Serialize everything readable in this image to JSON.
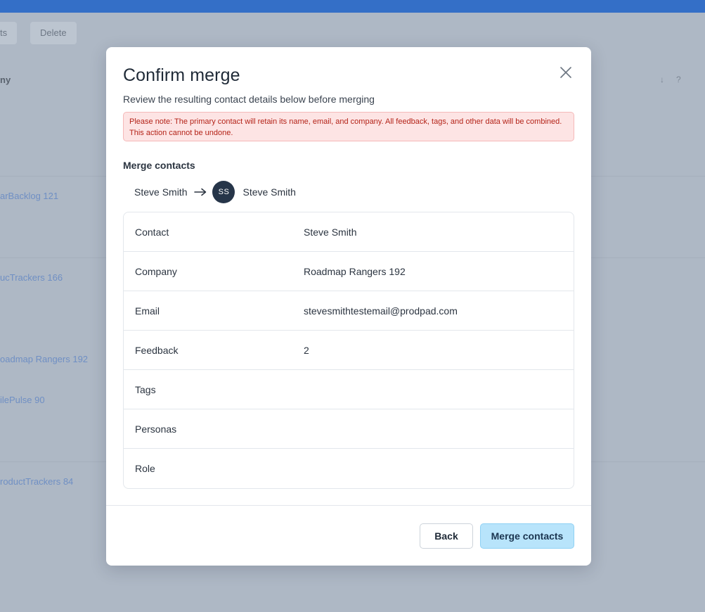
{
  "background": {
    "toolbar_buttons": [
      "ts",
      "Delete"
    ],
    "column_header": "ny",
    "company_links": [
      "arBacklog 121",
      "ucTrackers 166",
      "oadmap Rangers 192",
      "ilePulse 90",
      "roductTrackers 84"
    ],
    "sort_icons": [
      "↓",
      "?"
    ]
  },
  "modal": {
    "title": "Confirm merge",
    "subtitle": "Review the resulting contact details below before merging",
    "alert": "Please note: The primary contact will retain its name, email, and company. All feedback, tags, and other data will be combined. This action cannot be undone.",
    "section_title": "Merge contacts",
    "merge": {
      "source_name": "Steve Smith",
      "avatar_initials": "SS",
      "target_name": "Steve Smith"
    },
    "details": [
      {
        "label": "Contact",
        "value": "Steve Smith"
      },
      {
        "label": "Company",
        "value": "Roadmap Rangers 192"
      },
      {
        "label": "Email",
        "value": "stevesmithtestemail@prodpad.com"
      },
      {
        "label": "Feedback",
        "value": "2"
      },
      {
        "label": "Tags",
        "value": ""
      },
      {
        "label": "Personas",
        "value": ""
      },
      {
        "label": "Role",
        "value": ""
      }
    ],
    "buttons": {
      "back": "Back",
      "merge": "Merge contacts"
    }
  },
  "colors": {
    "topbar": "#346fc7",
    "overlay": "#aeb8c5",
    "alert_bg": "#fde4e4",
    "alert_text": "#b42318",
    "avatar_bg": "#263549",
    "primary_button": "#b8e4fb"
  },
  "icons": {
    "close": "close-icon",
    "arrow": "arrow-right-icon"
  }
}
